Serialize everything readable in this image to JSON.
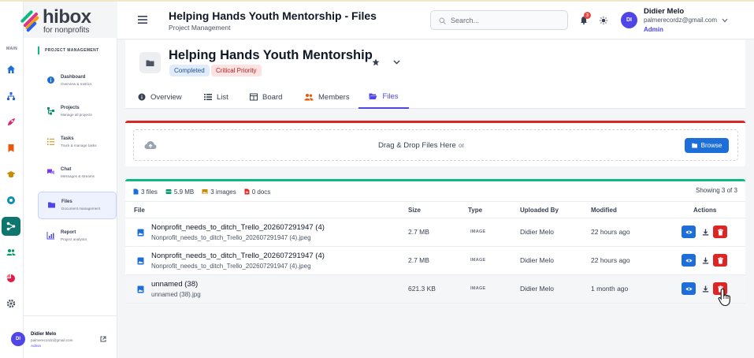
{
  "brand": {
    "name": "hibox",
    "tagline": "for nonprofits",
    "colors": {
      "accent": "#4f46e5",
      "success": "#10b981",
      "danger": "#dc2626",
      "primary_button": "#1d6ed8"
    }
  },
  "rail": {
    "label": "MAIN",
    "icons": [
      "home-icon",
      "hierarchy-icon",
      "rocket-icon",
      "bookmark-icon",
      "graduation-cap-icon",
      "gear-badge-icon",
      "network-icon",
      "users-icon",
      "pie-icon",
      "settings-icon"
    ]
  },
  "sidebar": {
    "section": "PROJECT MANAGEMENT",
    "items": [
      {
        "label": "Dashboard",
        "sub": "Overview & metrics",
        "icon": "info-circle-icon"
      },
      {
        "label": "Projects",
        "sub": "Manage all projects",
        "icon": "project-tree-icon"
      },
      {
        "label": "Tasks",
        "sub": "Track & manage tasks",
        "icon": "task-list-icon"
      },
      {
        "label": "Chat",
        "sub": "Messages & streams",
        "icon": "chat-icon"
      },
      {
        "label": "Files",
        "sub": "Document management",
        "icon": "folder-icon"
      },
      {
        "label": "Report",
        "sub": "Project analytics",
        "icon": "chart-icon"
      }
    ],
    "user": {
      "initials": "DI",
      "name": "Didier Melo",
      "email": "palmerecordz@gmail.com",
      "role": "Admin"
    }
  },
  "header": {
    "title": "Helping Hands Youth Mentorship - Files",
    "subtitle": "Project Management",
    "search_placeholder": "Search...",
    "notification_count": "3",
    "user": {
      "initials": "DI",
      "name": "Didier Melo",
      "email": "palmerecordz@gmail.com",
      "role": "Admin"
    }
  },
  "project": {
    "title": "Helping Hands Youth Mentorship",
    "status": "Completed",
    "priority": "Critical Priority"
  },
  "tabs": [
    {
      "label": "Overview",
      "icon": "info-icon"
    },
    {
      "label": "List",
      "icon": "list-icon"
    },
    {
      "label": "Board",
      "icon": "board-icon"
    },
    {
      "label": "Members",
      "icon": "members-icon"
    },
    {
      "label": "Files",
      "icon": "folder-open-icon",
      "active": true
    }
  ],
  "upload": {
    "drop_text": "Drag & Drop Files Here",
    "or_text": "or",
    "browse_label": "Browse"
  },
  "files": {
    "stats": {
      "files": "3 files",
      "size": "5.9 MB",
      "images": "3 images",
      "docs": "0 docs"
    },
    "showing": "Showing 3 of 3",
    "columns": [
      "File",
      "Size",
      "Type",
      "Uploaded By",
      "Modified",
      "Actions"
    ],
    "rows": [
      {
        "name": "Nonprofit_needs_to_ditch_Trello_202607291947 (4)",
        "filename": "Nonprofit_needs_to_ditch_Trello_202607291947 (4).jpeg",
        "size": "2.7 MB",
        "type": "IMAGE",
        "uploaded_by": "Didier Melo",
        "modified": "22 hours ago"
      },
      {
        "name": "Nonprofit_needs_to_ditch_Trello_202607291947 (4)",
        "filename": "Nonprofit_needs_to_ditch_Trello_202607291947 (4).jpeg",
        "size": "2.7 MB",
        "type": "IMAGE",
        "uploaded_by": "Didier Melo",
        "modified": "22 hours ago"
      },
      {
        "name": "unnamed (38)",
        "filename": "unnamed (38).jpg",
        "size": "621.3 KB",
        "type": "IMAGE",
        "uploaded_by": "Didier Melo",
        "modified": "1 month ago"
      }
    ]
  }
}
